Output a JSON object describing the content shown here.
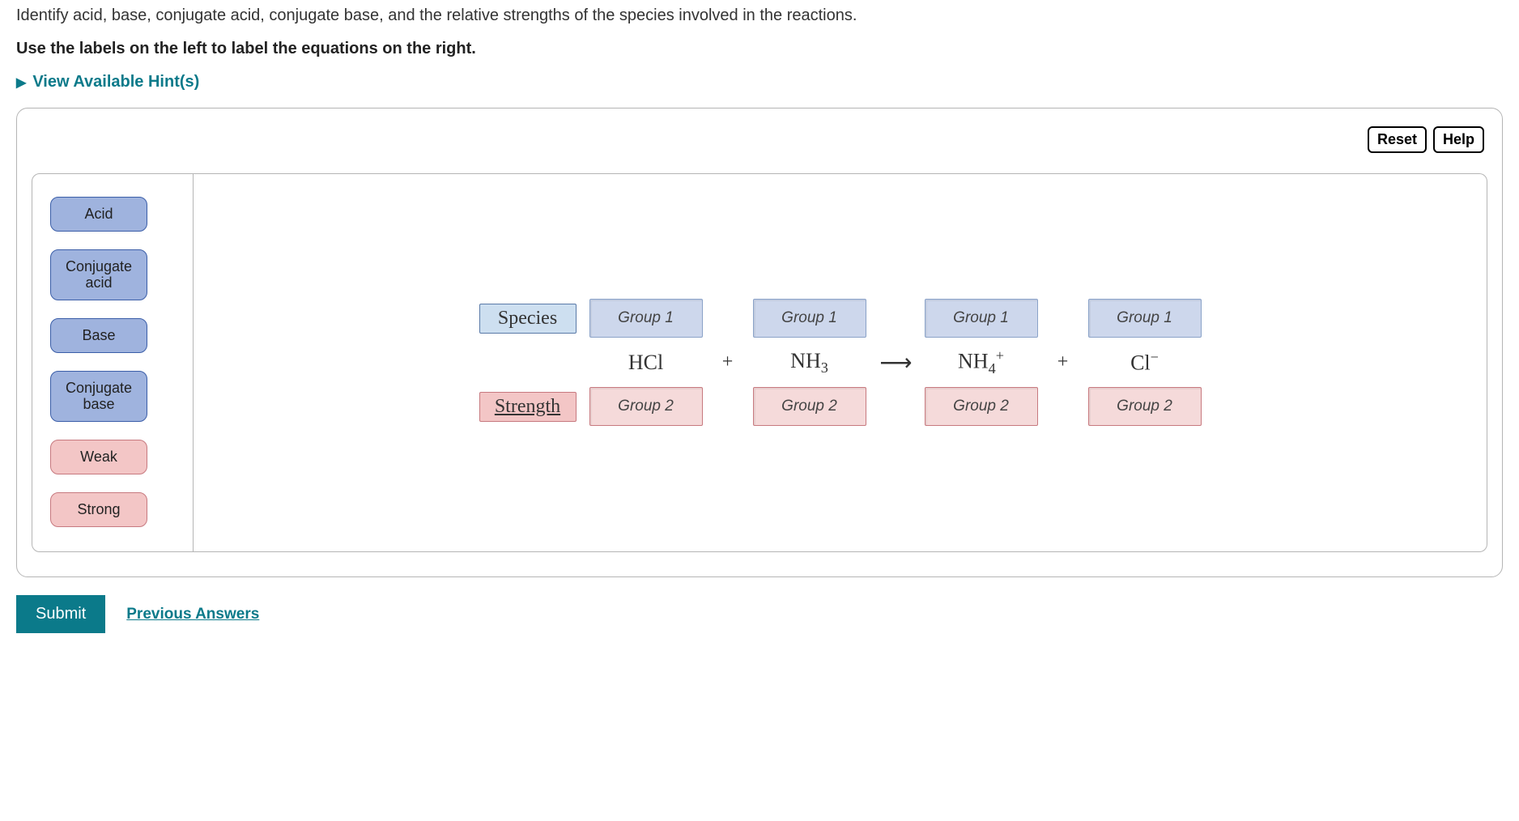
{
  "intro": "Identify acid, base, conjugate acid, conjugate base, and the relative strengths of the species involved in the reactions.",
  "instruction": "Use the labels on the left to label the equations on the right.",
  "hints_label": "View Available Hint(s)",
  "buttons": {
    "reset": "Reset",
    "help": "Help",
    "submit": "Submit",
    "prev": "Previous Answers"
  },
  "labels": {
    "acid": "Acid",
    "conj_acid": "Conjugate acid",
    "base": "Base",
    "conj_base": "Conjugate base",
    "weak": "Weak",
    "strong": "Strong"
  },
  "row_headers": {
    "species": "Species",
    "strength": "Strength"
  },
  "slot_groups": {
    "g1": "Group 1",
    "g2": "Group 2"
  },
  "equation": {
    "r1": "HCl",
    "plus": "+",
    "r2_base": "NH",
    "r2_sub": "3",
    "arrow": "→",
    "p1_base": "NH",
    "p1_sub": "4",
    "p1_sup": "+",
    "p2_base": "Cl",
    "p2_sup": "−"
  }
}
